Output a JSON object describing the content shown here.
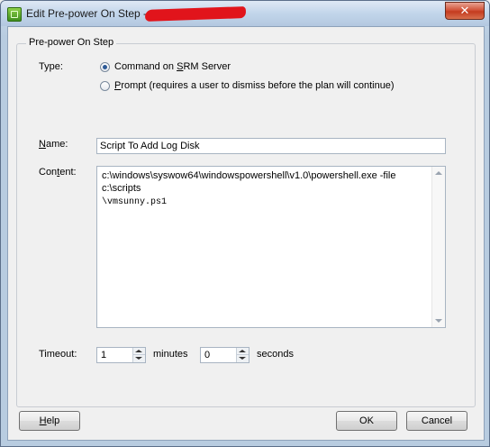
{
  "window": {
    "title": "Edit Pre-power On Step -",
    "close_glyph": "✕"
  },
  "group": {
    "title": "Pre-power On Step"
  },
  "type": {
    "label": "Type:",
    "options": [
      {
        "accel": "S",
        "pre": "Command on ",
        "post": "RM Server",
        "selected": true
      },
      {
        "accel": "P",
        "pre": "",
        "post": "rompt (requires a user to dismiss before the plan will continue)",
        "selected": false
      }
    ]
  },
  "name": {
    "label_accel": "N",
    "label_rest": "ame:",
    "value": "Script To Add Log Disk"
  },
  "content": {
    "label_pre": "Con",
    "label_accel": "t",
    "label_post": "ent:",
    "line1": "c:\\windows\\syswow64\\windowspowershell\\v1.0\\powershell.exe -file c:\\scripts",
    "line2": "\\vmsunny.ps1"
  },
  "timeout": {
    "label": "Timeout:",
    "minutes_value": "1",
    "minutes_label": "minutes",
    "seconds_value": "0",
    "seconds_label": "seconds"
  },
  "buttons": {
    "help_accel": "H",
    "help_rest": "elp",
    "ok": "OK",
    "cancel": "Cancel"
  }
}
